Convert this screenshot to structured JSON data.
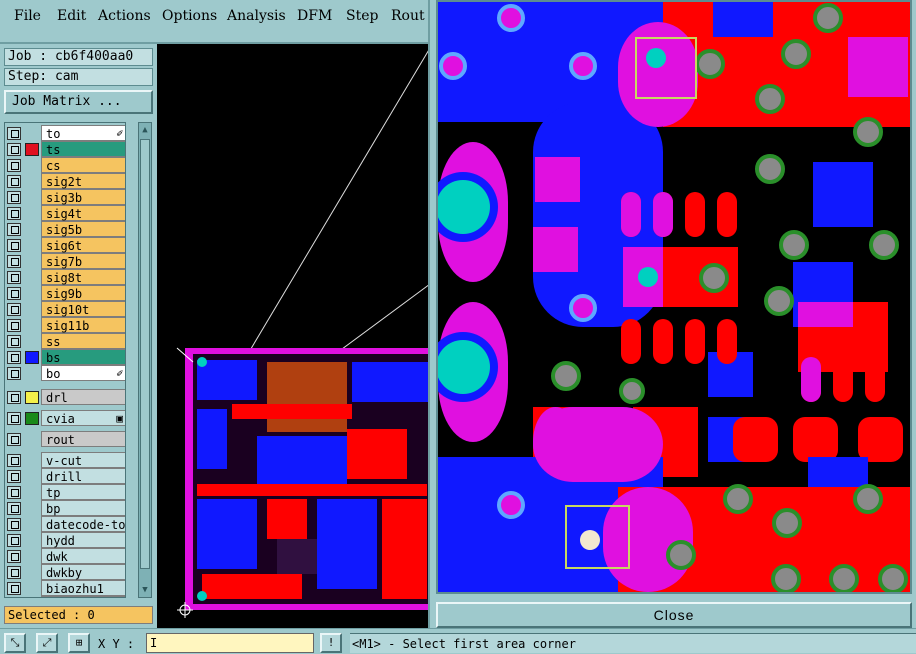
{
  "menu": [
    "File",
    "Edit",
    "Actions",
    "Options",
    "Analysis",
    "DFM",
    "Step",
    "Rout"
  ],
  "job": "Job : cb6f400aa0",
  "step": "Step: cam",
  "job_matrix": "Job Matrix ...",
  "layers": [
    {
      "name": "to",
      "style": "w",
      "swatch": "",
      "mark": "✐"
    },
    {
      "name": "ts",
      "style": "t",
      "swatch": "#e01020",
      "mark": ""
    },
    {
      "name": "cs",
      "style": "o",
      "swatch": "",
      "mark": ""
    },
    {
      "name": "sig2t",
      "style": "o",
      "swatch": "",
      "mark": ""
    },
    {
      "name": "sig3b",
      "style": "o",
      "swatch": "",
      "mark": ""
    },
    {
      "name": "sig4t",
      "style": "o",
      "swatch": "",
      "mark": ""
    },
    {
      "name": "sig5b",
      "style": "o",
      "swatch": "",
      "mark": ""
    },
    {
      "name": "sig6t",
      "style": "o",
      "swatch": "",
      "mark": ""
    },
    {
      "name": "sig7b",
      "style": "o",
      "swatch": "",
      "mark": ""
    },
    {
      "name": "sig8t",
      "style": "o",
      "swatch": "",
      "mark": ""
    },
    {
      "name": "sig9b",
      "style": "o",
      "swatch": "",
      "mark": ""
    },
    {
      "name": "sig10t",
      "style": "o",
      "swatch": "",
      "mark": ""
    },
    {
      "name": "sig11b",
      "style": "o",
      "swatch": "",
      "mark": ""
    },
    {
      "name": "ss",
      "style": "o",
      "swatch": "",
      "mark": ""
    },
    {
      "name": "bs",
      "style": "t",
      "swatch": "#1018ff",
      "mark": ""
    },
    {
      "name": "bo",
      "style": "w",
      "swatch": "",
      "mark": "✐"
    }
  ],
  "drill_layers": [
    {
      "name": "drl",
      "style": "g",
      "swatch": "#f4f04a",
      "mark": ""
    },
    {
      "name": "cvia",
      "style": "c",
      "swatch": "#1a8a1a",
      "mark": "▣"
    },
    {
      "name": "rout",
      "style": "g",
      "swatch": "",
      "mark": ""
    }
  ],
  "misc_layers": [
    "v-cut",
    "drill",
    "tp",
    "bp",
    "datecode-to",
    "hydd",
    "dwk",
    "dwkby",
    "biaozhu1",
    "biaozhu"
  ],
  "selected": "Selected : 0",
  "xy_label": "X Y :",
  "xy_value": "I",
  "prompt": "<M1> - Select first area corner",
  "close": "Close",
  "colors": {
    "panel": "#9ec9cc",
    "layer_orange": "#f5c460",
    "layer_teal": "#279b7e",
    "top_red": "#ff0000",
    "bottom_blue": "#1018ff",
    "overlap": "#ff00ff"
  }
}
